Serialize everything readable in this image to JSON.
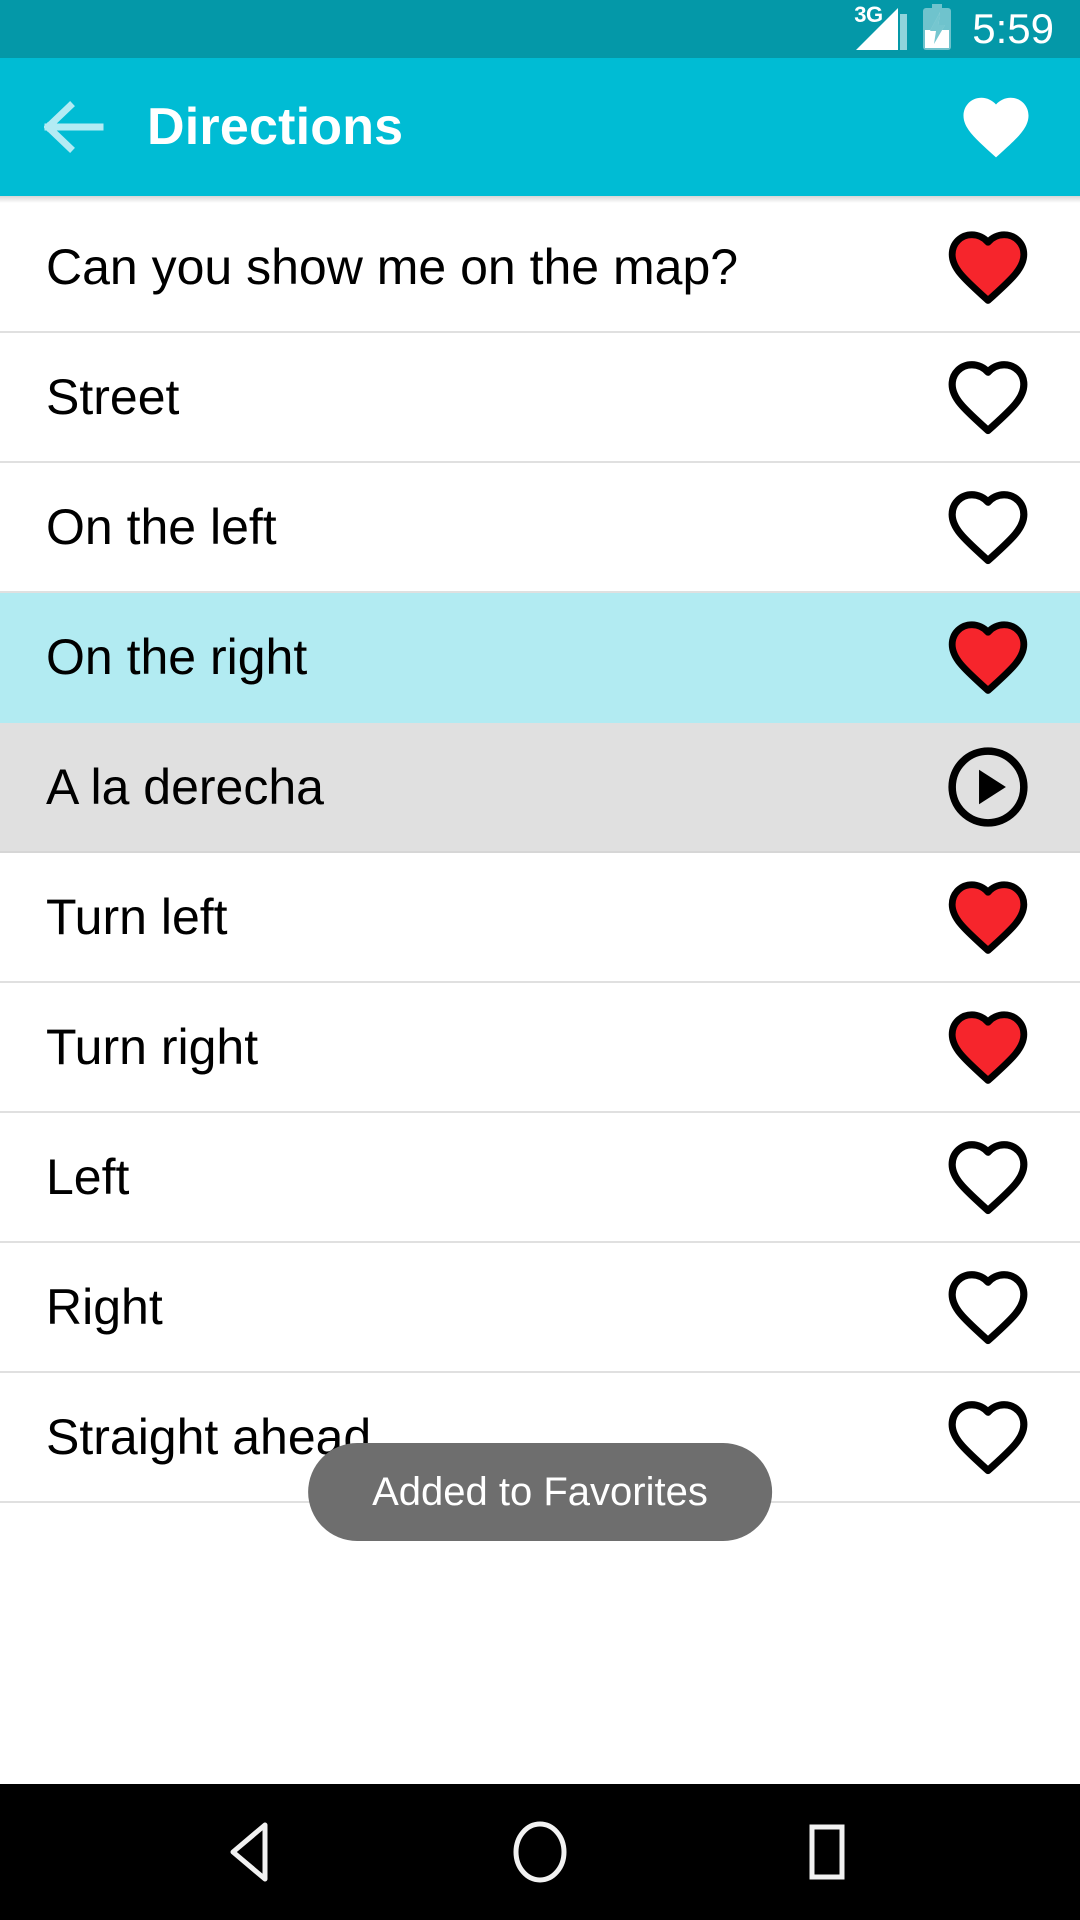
{
  "status_bar": {
    "network": "3G",
    "time": "5:59",
    "battery_icon": "battery-charging-icon",
    "signal_icon": "signal-bars-icon",
    "background_color": "#0498A8"
  },
  "app_bar": {
    "title": "Directions",
    "back_icon": "arrow-left-icon",
    "favorite_icon": "heart-filled-icon",
    "background_color": "#00BCD4",
    "title_color": "#FFFFFF"
  },
  "colors": {
    "accent": "#00BCD4",
    "selected_row": "#B2EBF2",
    "translation_row": "#E0E0E0",
    "heart_red": "#F6252C",
    "divider": "#E0E0E0",
    "toast_bg": "#6E6E6E"
  },
  "list": {
    "rows": [
      {
        "label": "Can you show me on the map?",
        "action_icon": "heart-filled-icon",
        "favorited": true,
        "state": "normal"
      },
      {
        "label": "Street",
        "action_icon": "heart-outline-icon",
        "favorited": false,
        "state": "normal"
      },
      {
        "label": "On the left",
        "action_icon": "heart-outline-icon",
        "favorited": false,
        "state": "normal"
      },
      {
        "label": "On the right",
        "action_icon": "heart-filled-icon",
        "favorited": true,
        "state": "selected"
      },
      {
        "label": "A la derecha",
        "action_icon": "play-circle-icon",
        "favorited": false,
        "state": "translation"
      },
      {
        "label": "Turn left",
        "action_icon": "heart-filled-icon",
        "favorited": true,
        "state": "normal"
      },
      {
        "label": "Turn right",
        "action_icon": "heart-filled-icon",
        "favorited": true,
        "state": "normal"
      },
      {
        "label": "Left",
        "action_icon": "heart-outline-icon",
        "favorited": false,
        "state": "normal"
      },
      {
        "label": "Right",
        "action_icon": "heart-outline-icon",
        "favorited": false,
        "state": "normal"
      },
      {
        "label": "Straight ahead",
        "action_icon": "heart-outline-icon",
        "favorited": false,
        "state": "normal"
      }
    ]
  },
  "toast": {
    "message": "Added to Favorites"
  },
  "nav_bar": {
    "back_label": "back-triangle-icon",
    "home_label": "home-circle-icon",
    "recents_label": "recents-square-icon"
  }
}
